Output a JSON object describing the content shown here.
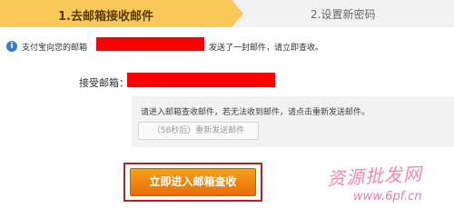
{
  "steps": {
    "step1": "1.去邮箱接收邮件",
    "step2": "2.设置新密码"
  },
  "notice": {
    "prefix": "支付宝向您的邮箱",
    "suffix": "发送了一封邮件，请立即查收。"
  },
  "email": {
    "label": "接受邮箱："
  },
  "help": {
    "text": "请进入邮箱查收邮件，若无法收到邮件，请点击重新发送邮件。",
    "resend_button": "（58秒后）重新发送邮件"
  },
  "primary_button": "立即进入邮箱查收",
  "watermark": {
    "line1": "资源批发网",
    "line2": "www.6pf.cn"
  },
  "colors": {
    "step_active": "#f8c85a",
    "redaction": "#ff0000",
    "button_orange": "#f08a10",
    "highlight_border": "#b3231f"
  }
}
